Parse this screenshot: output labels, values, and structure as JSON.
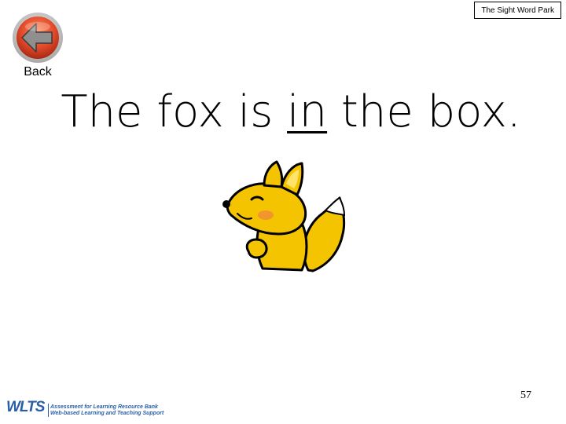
{
  "header": {
    "title": "The Sight Word Park"
  },
  "navigation": {
    "back_label": "Back",
    "back_icon": "arrow-left-icon",
    "back_colors": {
      "outer": "#c8c8c8",
      "inner": "#e2492a",
      "arrow": "#8f8f8f"
    }
  },
  "main": {
    "sentence_before": "The fox is ",
    "sight_word": "in",
    "sentence_after": " the box.",
    "illustration": "fox-icon",
    "fox_colors": {
      "body": "#f5c400",
      "outline": "#000000",
      "cheek": "#f08a3a"
    }
  },
  "footer": {
    "page_number": "57",
    "logo_mark": "WLTS",
    "logo_line1": "Assessment for Learning Resource Bank",
    "logo_line2": "Web-based Learning and Teaching Support",
    "logo_color": "#2a5fa8"
  }
}
